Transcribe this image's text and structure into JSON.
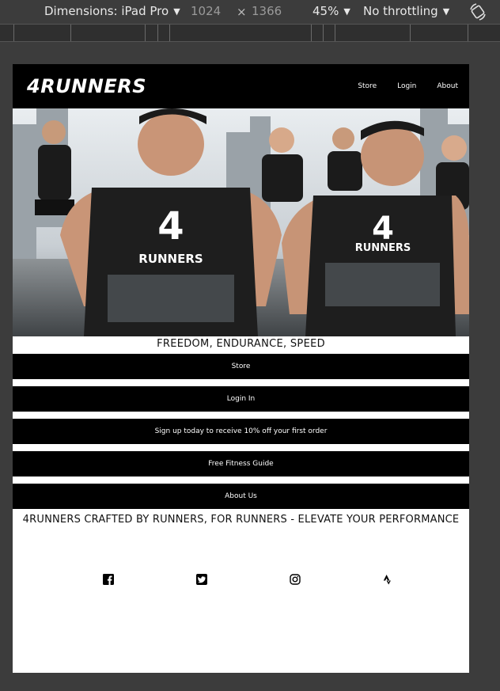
{
  "devtools": {
    "dimensions_label": "Dimensions: iPad Pro",
    "width": "1024",
    "height": "1366",
    "zoom": "45%",
    "throttling": "No throttling"
  },
  "site": {
    "logo": "4RUNNERS",
    "nav": [
      "Store",
      "Login",
      "About"
    ],
    "hero_image": "runners-hero-image",
    "tagline": "FREEDOM, ENDURANCE, SPEED",
    "buttons": [
      "Store",
      "Login In",
      "Sign up today to receive 10% off your first order",
      "Free Fitness Guide",
      "About Us"
    ],
    "slogan": "4RUNNERS CRAFTED BY RUNNERS, FOR RUNNERS - ELEVATE YOUR PERFORMANCE",
    "social_icons": [
      "facebook-icon",
      "twitter-icon",
      "instagram-icon",
      "strava-icon"
    ]
  }
}
